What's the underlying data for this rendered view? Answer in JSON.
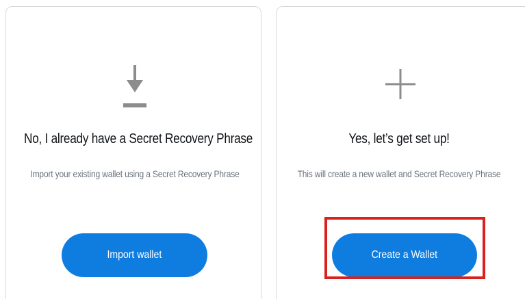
{
  "import_card": {
    "icon": "download-icon",
    "title": "No, I already have a Secret Recovery Phrase",
    "subtitle": "Import your existing wallet using a Secret Recovery Phrase",
    "button_label": "Import wallet"
  },
  "create_card": {
    "icon": "plus-icon",
    "title": "Yes, let’s get set up!",
    "subtitle": "This will create a new wallet and Secret Recovery Phrase",
    "button_label": "Create a Wallet"
  },
  "colors": {
    "primary_button": "#0f7de0",
    "highlight_outline": "#d9211d",
    "icon_gray": "#8c8c8c"
  }
}
